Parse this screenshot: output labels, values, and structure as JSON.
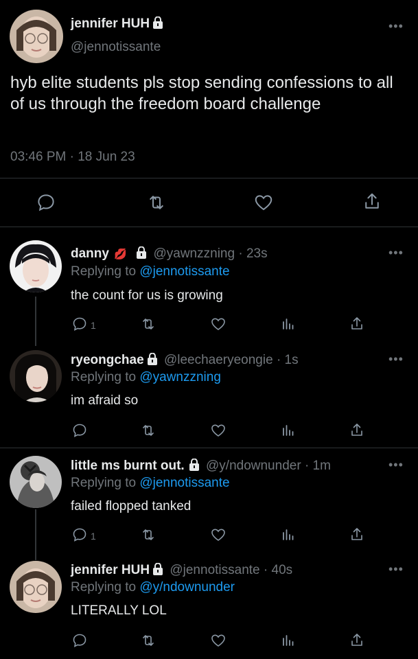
{
  "main_tweet": {
    "name": "jennifer HUH",
    "handle": "@jennotissante",
    "text": "hyb elite students pls stop sending confessions to all of us through the freedom board challenge",
    "timestamp": "03:46 PM · 18 Jun 23"
  },
  "replies": [
    {
      "name": "danny",
      "handle": "@yawnzzning",
      "time": "· 23s",
      "replying_label": "Replying to",
      "replying_to": "@jennotissante",
      "text": "the count for us is growing",
      "reply_count": "1"
    },
    {
      "name": "ryeongchae",
      "handle": "@leechaeryeongie",
      "time": "· 1s",
      "replying_label": "Replying to",
      "replying_to": "@yawnzzning",
      "text": "im afraid so",
      "reply_count": ""
    },
    {
      "name": "little ms burnt out.",
      "handle": "@y/ndownunder",
      "time": "· 1m",
      "replying_label": "Replying to",
      "replying_to": "@jennotissante",
      "text": "failed flopped tanked",
      "reply_count": "1"
    },
    {
      "name": "jennifer HUH",
      "handle": "@jennotissante",
      "time": "· 40s",
      "replying_label": "Replying to",
      "replying_to": "@y/ndownunder",
      "text": "LITERALLY LOL",
      "reply_count": ""
    }
  ],
  "more_glyph": "•••",
  "emoji": "💋",
  "colors": {
    "background": "#000000",
    "text": "#e7e9ea",
    "muted": "#71767b",
    "link": "#1d9bf0",
    "divider": "#2f3336"
  }
}
